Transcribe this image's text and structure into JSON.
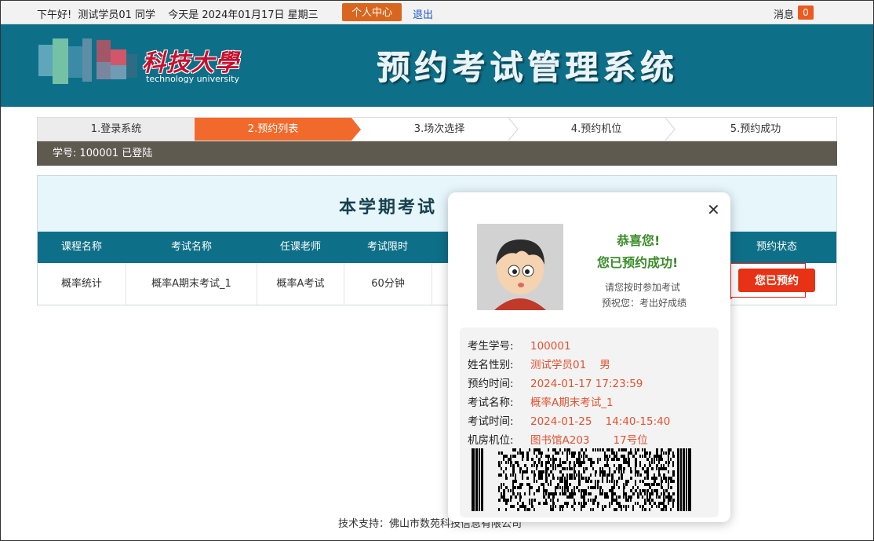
{
  "topbar": {
    "greeting": "下午好!",
    "user": "测试学员01 同学",
    "date": "今天是 2024年01月17日 星期三",
    "personal_center": "个人中心",
    "logout": "退出",
    "messages_label": "消息",
    "messages_count": "0"
  },
  "header": {
    "logo_cn": "科技大學",
    "logo_en": "technology university",
    "system_title": "预约考试管理系统"
  },
  "steps": [
    "1.登录系统",
    "2.预约列表",
    "3.场次选择",
    "4.预约机位",
    "5.预约成功"
  ],
  "id_bar": "学号: 100001 已登陆",
  "panel": {
    "title": "本学期考试",
    "columns": [
      "课程名称",
      "考试名称",
      "任课老师",
      "考试限时",
      "预约状态"
    ],
    "row": {
      "course": "概率统计",
      "exam": "概率A期末考试_1",
      "teacher": "概率A考试",
      "duration": "60分钟",
      "status_button": "您已预约"
    }
  },
  "footer": "技术支持：佛山市数苑科技信息有限公司",
  "popup": {
    "congrats_1": "恭喜您!",
    "congrats_2": "您已预约成功!",
    "note_1": "请您按时参加考试",
    "note_2": "预祝您：考出好成绩",
    "fields": [
      {
        "label": "考生学号:",
        "value": "100001"
      },
      {
        "label": "姓名性别:",
        "value": "测试学员01    男"
      },
      {
        "label": "预约时间:",
        "value": "2024-01-17 17:23:59"
      },
      {
        "label": "考试名称:",
        "value": "概率A期末考试_1"
      },
      {
        "label": "考试时间:",
        "value": "2024-01-25    14:40-15:40"
      },
      {
        "label": "机房机位:",
        "value": "图书馆A203       17号位"
      }
    ]
  },
  "colors": {
    "teal": "#0e6f88",
    "orange": "#f16a2b",
    "red": "#e73215",
    "green": "#3b8a2a"
  }
}
